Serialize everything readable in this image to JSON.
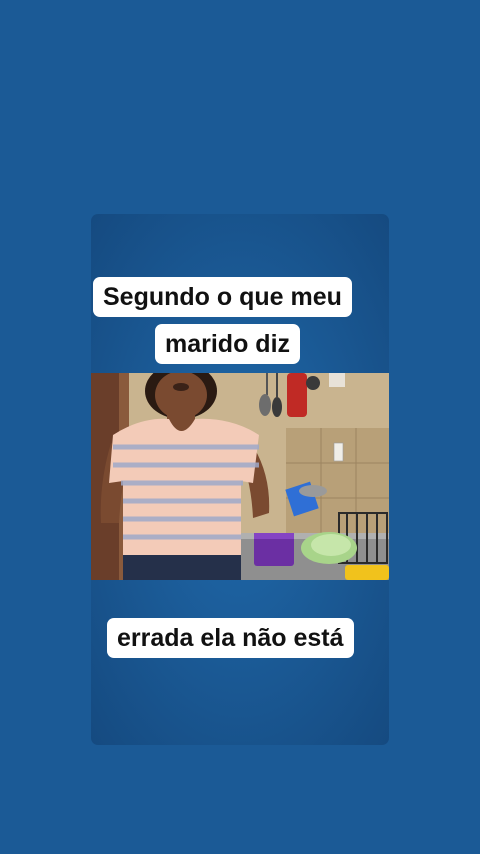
{
  "captions": {
    "top_line_1": "Segundo o que meu",
    "top_line_2": "marido diz",
    "bottom": "errada ela não está"
  },
  "video": {
    "scene": "woman-in-kitchen"
  },
  "colors": {
    "background": "#1b5a96",
    "card": "#1a5893",
    "caption_bg": "#ffffff",
    "caption_text": "#111111"
  }
}
